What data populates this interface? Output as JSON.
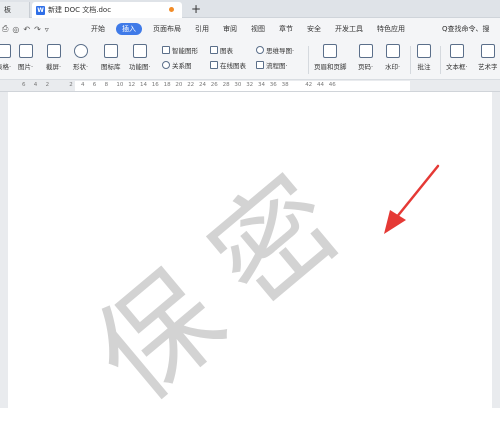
{
  "tabs": {
    "prev": "板",
    "active": "新建 DOC 文档.doc",
    "doc_icon": "W",
    "new": "+"
  },
  "menu": {
    "items": [
      "开始",
      "插入",
      "页面布局",
      "引用",
      "审阅",
      "视图",
      "章节",
      "安全",
      "开发工具",
      "特色应用"
    ],
    "selected_index": 1,
    "search": "Q查找命令、搜"
  },
  "ribbon": {
    "big": [
      "表格·",
      "图片·",
      "截屏·",
      "形状·",
      "图标库",
      "功能图·",
      "页眉和页脚",
      "页码·",
      "水印·",
      "批注",
      "文本框·",
      "艺术字"
    ],
    "small": [
      "智能图形",
      "图表",
      "思维导图·",
      "关系图",
      "在线图表",
      "流程图·"
    ]
  },
  "ruler": {
    "numbers": [
      "6",
      "4",
      "2",
      "",
      "2",
      "4",
      "6",
      "8",
      "10",
      "12",
      "14",
      "16",
      "18",
      "20",
      "22",
      "24",
      "26",
      "28",
      "30",
      "32",
      "34",
      "36",
      "38",
      "",
      "42",
      "44",
      "46"
    ]
  },
  "watermark": {
    "char1": "保",
    "char2": "密"
  },
  "colors": {
    "accent": "#3f7ae8",
    "arrow": "#e53935",
    "watermark": "#d3d3d3"
  }
}
